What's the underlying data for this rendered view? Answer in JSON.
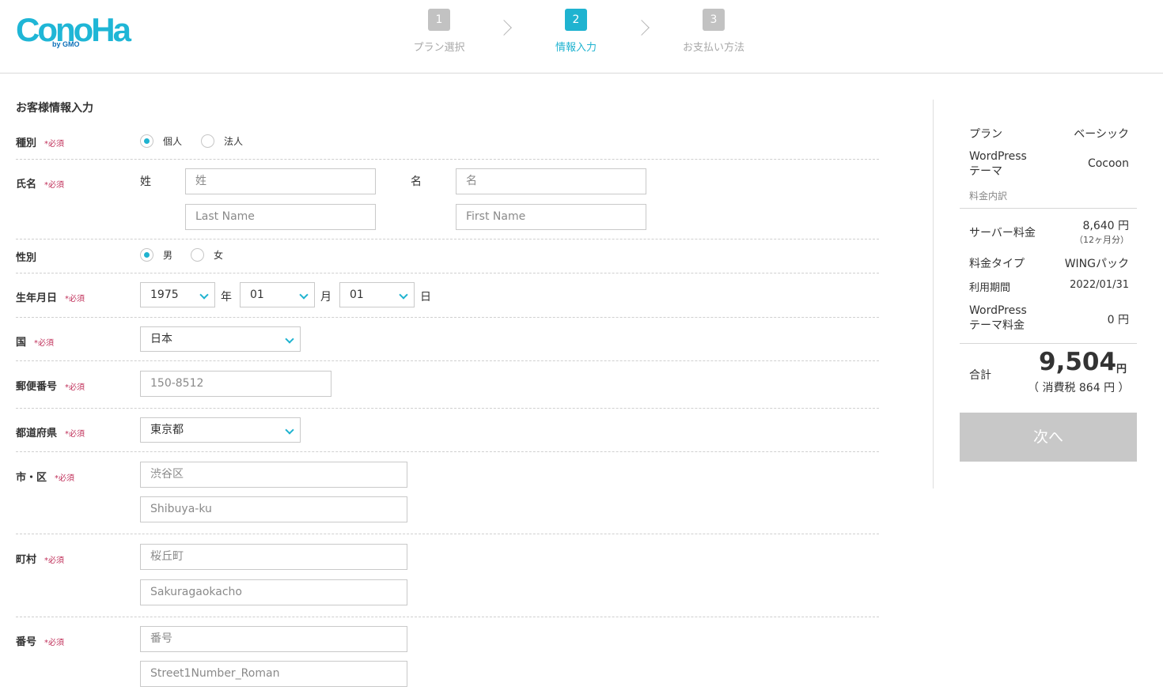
{
  "brand": {
    "logo_text": "ConoHa",
    "logo_sub": "by GMO"
  },
  "steps": [
    {
      "num": "1",
      "label": "プラン選択"
    },
    {
      "num": "2",
      "label": "情報入力"
    },
    {
      "num": "3",
      "label": "お支払い方法"
    }
  ],
  "form": {
    "title": "お客様情報入力",
    "required_mark": "*必須",
    "type": {
      "label": "種別",
      "options": [
        "個人",
        "法人"
      ],
      "selected": "個人"
    },
    "name": {
      "label": "氏名",
      "last_label": "姓",
      "first_label": "名",
      "last_placeholder": "姓",
      "first_placeholder": "名",
      "last_roman_placeholder": "Last Name",
      "first_roman_placeholder": "First Name"
    },
    "gender": {
      "label": "性別",
      "options": [
        "男",
        "女"
      ],
      "selected": "男"
    },
    "birthday": {
      "label": "生年月日",
      "year": "1975",
      "year_unit": "年",
      "month": "01",
      "month_unit": "月",
      "day": "01",
      "day_unit": "日"
    },
    "country": {
      "label": "国",
      "value": "日本"
    },
    "postal": {
      "label": "郵便番号",
      "placeholder": "150-8512"
    },
    "prefecture": {
      "label": "都道府県",
      "value": "東京都"
    },
    "city": {
      "label": "市・区",
      "placeholder": "渋谷区",
      "roman_placeholder": "Shibuya-ku"
    },
    "town": {
      "label": "町村",
      "placeholder": "桜丘町",
      "roman_placeholder": "Sakuragaokacho"
    },
    "number": {
      "label": "番号",
      "placeholder": "番号",
      "roman_placeholder": "Street1Number_Roman"
    }
  },
  "summary": {
    "plan_key": "プラン",
    "plan_val": "ベーシック",
    "theme_key_1": "WordPress",
    "theme_key_2": "テーマ",
    "theme_val": "Cocoon",
    "breakdown_label": "料金内訳",
    "server_key": "サーバー料金",
    "server_val": "8,640 円",
    "server_sub": "（12ヶ月分）",
    "fee_type_key": "料金タイプ",
    "fee_type_val": "WINGパック",
    "period_key": "利用期間",
    "period_val": "2022/01/31",
    "theme_fee_key_1": "WordPress",
    "theme_fee_key_2": "テーマ料金",
    "theme_fee_val": "0 円",
    "total_key": "合計",
    "total_val": "9,504",
    "total_unit": "円",
    "tax": "（ 消費税 864 円 ）",
    "next_button": "次へ"
  },
  "colors": {
    "accent": "#1fb3d0",
    "required": "#c0305a",
    "disabled_button": "#c8c8c8"
  }
}
